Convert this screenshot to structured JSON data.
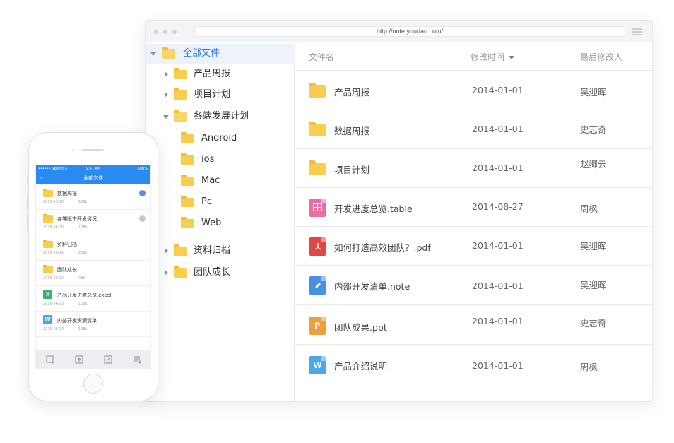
{
  "browser": {
    "url": "http://note.youdao.com/"
  },
  "sidebar": {
    "root": {
      "label": "全部文件"
    },
    "items": [
      {
        "label": "产品周报",
        "expanded": false
      },
      {
        "label": "项目计划",
        "expanded": false
      },
      {
        "label": "各端发展计划",
        "expanded": true,
        "children": [
          {
            "label": "Android"
          },
          {
            "label": "ios"
          },
          {
            "label": "Mac"
          },
          {
            "label": "Pc"
          },
          {
            "label": "Web"
          }
        ]
      },
      {
        "label": "资料归档",
        "expanded": false
      },
      {
        "label": "团队成长",
        "expanded": false
      }
    ]
  },
  "list": {
    "columns": {
      "name": "文件名",
      "modified": "修改时间",
      "modifier": "最后修改人"
    },
    "rows": [
      {
        "type": "folder",
        "name": "产品周报",
        "date": "2014-01-01",
        "user": "吴迎晖"
      },
      {
        "type": "folder",
        "name": "数据周报",
        "date": "2014-01-01",
        "user": "史志奇"
      },
      {
        "type": "folder",
        "name": "项目计划",
        "date": "2014-01-01",
        "user": "赵卿云"
      },
      {
        "type": "table",
        "name": "开发进度总览.table",
        "date": "2014-08-27",
        "user": "周枫",
        "color": "#e86fa0"
      },
      {
        "type": "pdf",
        "name": "如何打造高效团队？.pdf",
        "date": "2014-01-01",
        "user": "吴迎晖",
        "color": "#e04646"
      },
      {
        "type": "note",
        "name": "内部开发清单.note",
        "date": "2014-01-01",
        "user": "吴迎晖",
        "color": "#4a90e2"
      },
      {
        "type": "ppt",
        "name": "团队成果.ppt",
        "date": "2014-01-01",
        "user": "史志奇",
        "color": "#e9a23b",
        "glyph": "P"
      },
      {
        "type": "word",
        "name": "产品介绍说明",
        "date": "2014-01-01",
        "user": "周枫",
        "color": "#4aa8e8",
        "glyph": "W"
      }
    ]
  },
  "phone": {
    "status": {
      "carrier": "•••••• Sketch ≈",
      "time": "9:41 AM",
      "battery": "100%"
    },
    "nav_title": "全部文件",
    "back_icon": "‹",
    "rows": [
      {
        "type": "folder",
        "name": "数据周报",
        "date": "2015-03-20",
        "size": "128k",
        "badge": "globe-icon",
        "badge_color": "#5b8de8"
      },
      {
        "type": "folder",
        "name": "各端版本开发情况",
        "date": "2016-06-20",
        "size": "128k",
        "badge": "eye-icon",
        "badge_color": "#b5b9be"
      },
      {
        "type": "folder",
        "name": "资料归档",
        "date": "2016-06-21",
        "size": "256k"
      },
      {
        "type": "folder",
        "name": "团队成长",
        "date": "2016-06-22",
        "size": "48K"
      },
      {
        "type": "excel",
        "name": "产品开发进度总览.excel",
        "date": "2016-06-23",
        "size": "100k",
        "glyph": "X",
        "color": "#3cb371"
      },
      {
        "type": "word",
        "name": "内部开发资源清单",
        "date": "2016-06-24",
        "size": "128k",
        "glyph": "W",
        "color": "#4aa8e8"
      }
    ],
    "toolbar": [
      "new-note-icon",
      "upload-icon",
      "edit-icon",
      "sort-icon"
    ]
  }
}
